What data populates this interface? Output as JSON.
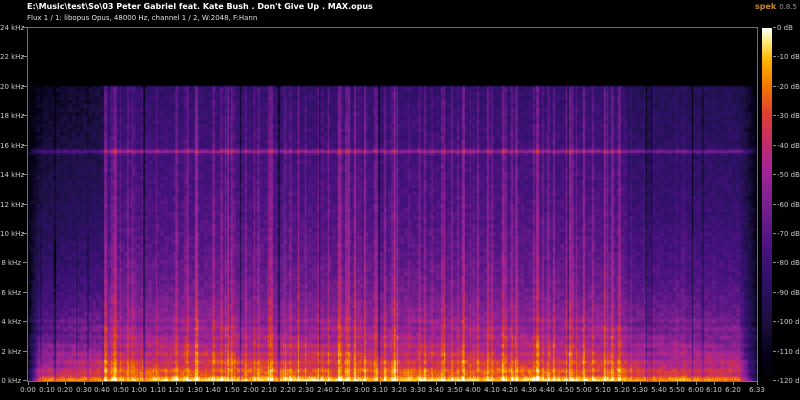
{
  "window": {
    "title": "E:\\Music\\test\\So\\03 Peter Gabriel feat. Kate Bush . Don't Give Up . MAX.opus",
    "info": "Flux 1 / 1: libopus Opus, 48000 Hz, channel 1 / 2, W:2048, F:Hann",
    "app_name": "spek",
    "app_version": "0.8.5"
  },
  "axes": {
    "freq_ticks": [
      "24 kHz",
      "22 kHz",
      "20 kHz",
      "18 kHz",
      "16 kHz",
      "14 kHz",
      "12 kHz",
      "10 kHz",
      "8 kHz",
      "6 kHz",
      "4 kHz",
      "2 kHz",
      "0 kHz"
    ],
    "freq_max_khz": 24,
    "time_ticks": [
      "0:00",
      "0:10",
      "0:20",
      "0:30",
      "0:40",
      "0:50",
      "1:00",
      "1:10",
      "1:20",
      "1:30",
      "1:40",
      "1:50",
      "2:00",
      "2:10",
      "2:20",
      "2:30",
      "2:40",
      "2:50",
      "3:00",
      "3:10",
      "3:20",
      "3:30",
      "3:40",
      "3:50",
      "4:00",
      "4:10",
      "4:20",
      "4:30",
      "4:40",
      "4:50",
      "5:00",
      "5:10",
      "5:20",
      "5:30",
      "5:40",
      "5:50",
      "6:00",
      "6:10",
      "6:20",
      "6:33"
    ],
    "db_ticks": [
      "0 dB",
      "-10 dB",
      "-20 dB",
      "-30 dB",
      "-40 dB",
      "-50 dB",
      "-60 dB",
      "-70 dB",
      "-80 dB",
      "-90 dB",
      "-100 dB",
      "-110 dB",
      "-120 dB"
    ],
    "db_range": 120
  },
  "spectrogram": {
    "duration_s": 393,
    "freq_max_hz": 24000,
    "lowpass_hz": 20000,
    "tone_line_hz": 15600,
    "sections": [
      {
        "start": 0,
        "end": 6,
        "low0": 0.1,
        "low1": 0.8,
        "high0": 0.05,
        "high1": 0.3,
        "stripes": 0.02,
        "stripe_fmax_hz": 6000
      },
      {
        "start": 6,
        "end": 40,
        "low0": 0.85,
        "low1": 0.95,
        "high0": 0.32,
        "high1": 0.5,
        "stripes": 0.1,
        "stripe_fmax_hz": 9000
      },
      {
        "start": 40,
        "end": 323,
        "low0": 1.0,
        "low1": 1.0,
        "high0": 1.0,
        "high1": 1.0,
        "stripes": 0.55,
        "stripe_fmax_hz": 20000
      },
      {
        "start": 323,
        "end": 384,
        "low0": 0.93,
        "low1": 0.9,
        "high0": 0.8,
        "high1": 0.75,
        "stripes": 0.15,
        "stripe_fmax_hz": 20000
      },
      {
        "start": 384,
        "end": 393,
        "low0": 0.85,
        "low1": 0.2,
        "high0": 0.7,
        "high1": 0.1,
        "stripes": 0.02,
        "stripe_fmax_hz": 20000
      }
    ],
    "freq_profile_khz_level": [
      [
        0,
        0.85
      ],
      [
        0.3,
        0.82
      ],
      [
        1,
        0.74
      ],
      [
        2,
        0.65
      ],
      [
        3,
        0.59
      ],
      [
        4,
        0.55
      ],
      [
        6,
        0.48
      ],
      [
        8,
        0.44
      ],
      [
        10,
        0.41
      ],
      [
        12,
        0.385
      ],
      [
        14,
        0.365
      ],
      [
        16,
        0.345
      ],
      [
        18,
        0.325
      ],
      [
        20,
        0.3
      ]
    ],
    "palette": [
      [
        0,
        "#000000"
      ],
      [
        0.08,
        "#08021c"
      ],
      [
        0.17,
        "#1b1040"
      ],
      [
        0.28,
        "#2d1166"
      ],
      [
        0.38,
        "#4a1280"
      ],
      [
        0.5,
        "#78208e"
      ],
      [
        0.6,
        "#a62498"
      ],
      [
        0.68,
        "#c42e66"
      ],
      [
        0.76,
        "#e04030"
      ],
      [
        0.84,
        "#f47a00"
      ],
      [
        0.91,
        "#ffb400"
      ],
      [
        0.96,
        "#ffe978"
      ],
      [
        1,
        "#ffffff"
      ]
    ]
  },
  "colors": {
    "background": "#000000",
    "frame": "#6e6e6e",
    "tick_text": "#c9c9c9",
    "title_text": "#ffffff",
    "logo_accent": "#c8882e"
  }
}
